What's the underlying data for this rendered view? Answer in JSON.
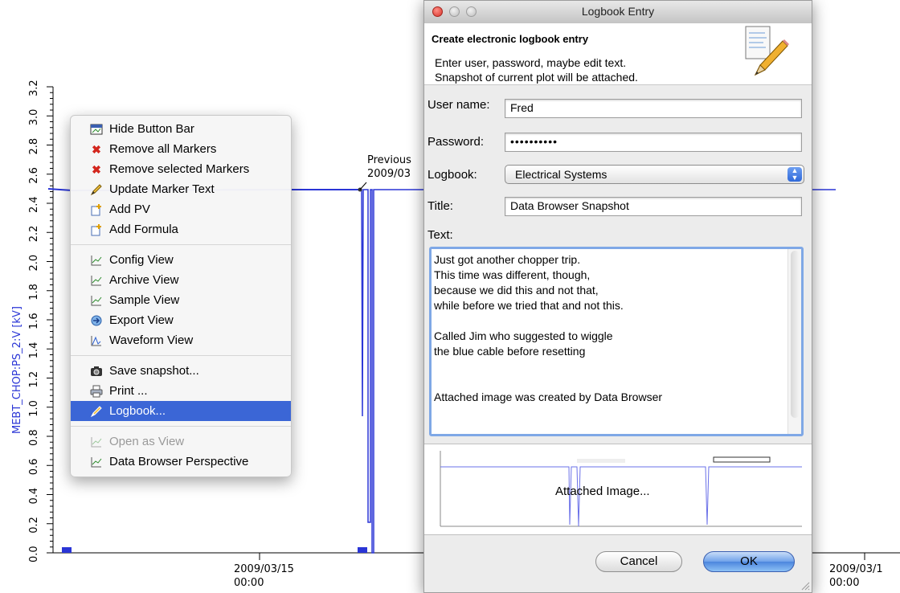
{
  "plot": {
    "y_axis_label": "MEBT_CHOP:PS_2:V [kV]",
    "y_ticks": [
      "0.0",
      "0.2",
      "0.4",
      "0.6",
      "0.8",
      "1.0",
      "1.2",
      "1.4",
      "1.6",
      "1.8",
      "2.0",
      "2.2",
      "2.4",
      "2.6",
      "2.8",
      "3.0",
      "3.2"
    ],
    "x_ticks": [
      {
        "date": "2009/03/15",
        "time": "00:00"
      },
      {
        "date": "2009/03/1",
        "time": "00:00"
      }
    ],
    "marker_label_line1": "Previous",
    "marker_label_line2": "2009/03",
    "trace_color": "#2a35d6"
  },
  "context_menu": {
    "items": [
      {
        "label": "Hide Button Bar",
        "icon": "hide-button-bar-icon"
      },
      {
        "label": "Remove all Markers",
        "icon": "red-x-icon"
      },
      {
        "label": "Remove selected Markers",
        "icon": "red-x-icon"
      },
      {
        "label": "Update Marker Text",
        "icon": "pencil-icon"
      },
      {
        "label": "Add PV",
        "icon": "add-pv-icon"
      },
      {
        "label": "Add Formula",
        "icon": "add-formula-icon"
      },
      {
        "label": "Config View",
        "icon": "view-chart-icon"
      },
      {
        "label": "Archive View",
        "icon": "view-chart-icon"
      },
      {
        "label": "Sample View",
        "icon": "view-chart-icon"
      },
      {
        "label": "Export View",
        "icon": "export-icon"
      },
      {
        "label": "Waveform View",
        "icon": "waveform-icon"
      },
      {
        "label": "Save snapshot...",
        "icon": "camera-icon"
      },
      {
        "label": "Print ...",
        "icon": "printer-icon"
      },
      {
        "label": "Logbook...",
        "icon": "pencil-icon"
      },
      {
        "label": "Open as View",
        "icon": "view-chart-icon"
      },
      {
        "label": "Data Browser Perspective",
        "icon": "view-chart-icon"
      }
    ]
  },
  "dialog": {
    "title": "Logbook Entry",
    "header_title": "Create electronic logbook entry",
    "header_desc_line1": "Enter user, password, maybe edit text.",
    "header_desc_line2": "Snapshot of current plot will be attached.",
    "user_label": "User name:",
    "user_value": "Fred",
    "password_label": "Password:",
    "password_value": "••••••••••",
    "logbook_label": "Logbook:",
    "logbook_value": "Electrical Systems",
    "title_label": "Title:",
    "title_value": "Data Browser Snapshot",
    "text_label": "Text:",
    "text_value": "Just got another chopper trip.\nThis time was different, though,\nbecause we did this and not that,\nwhile before we tried that and not this.\n\nCalled Jim who suggested to wiggle\nthe blue cable before resetting\n\n\nAttached image was created by Data Browser",
    "attached_label": "Attached Image...",
    "cancel_label": "Cancel",
    "ok_label": "OK"
  }
}
